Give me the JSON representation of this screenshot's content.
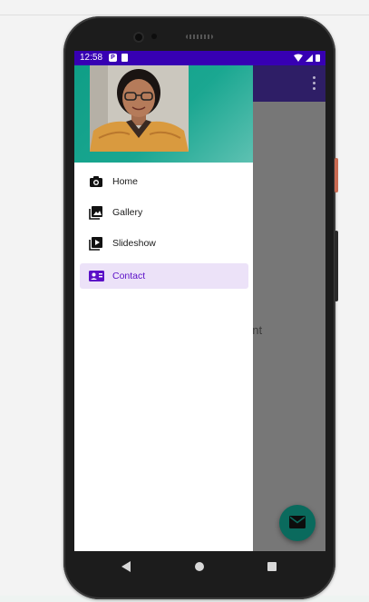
{
  "status_bar": {
    "time": "12:58",
    "badges": [
      "P",
      "🔒"
    ],
    "signal_icons": [
      "wifi-icon",
      "cellular-icon",
      "battery-icon"
    ]
  },
  "app_bar": {
    "overflow_icon": "more-vert-icon",
    "color": "#2e1e66"
  },
  "content": {
    "text": "ent"
  },
  "drawer": {
    "header_gradient": [
      "#0f9e86",
      "#5ec1b2"
    ],
    "items": [
      {
        "label": "Home",
        "icon": "camera-icon",
        "active": false
      },
      {
        "label": "Gallery",
        "icon": "gallery-icon",
        "active": false
      },
      {
        "label": "Slideshow",
        "icon": "slideshow-icon",
        "active": false
      },
      {
        "label": "Contact",
        "icon": "contact-card-icon",
        "active": true
      }
    ],
    "active_color": "#5b10c7",
    "active_background": "#ece2f8"
  },
  "fab": {
    "icon": "email-icon",
    "color": "#0a6a5d"
  },
  "nav_bar": {
    "buttons": [
      "back-icon",
      "home-icon",
      "recents-icon"
    ]
  }
}
